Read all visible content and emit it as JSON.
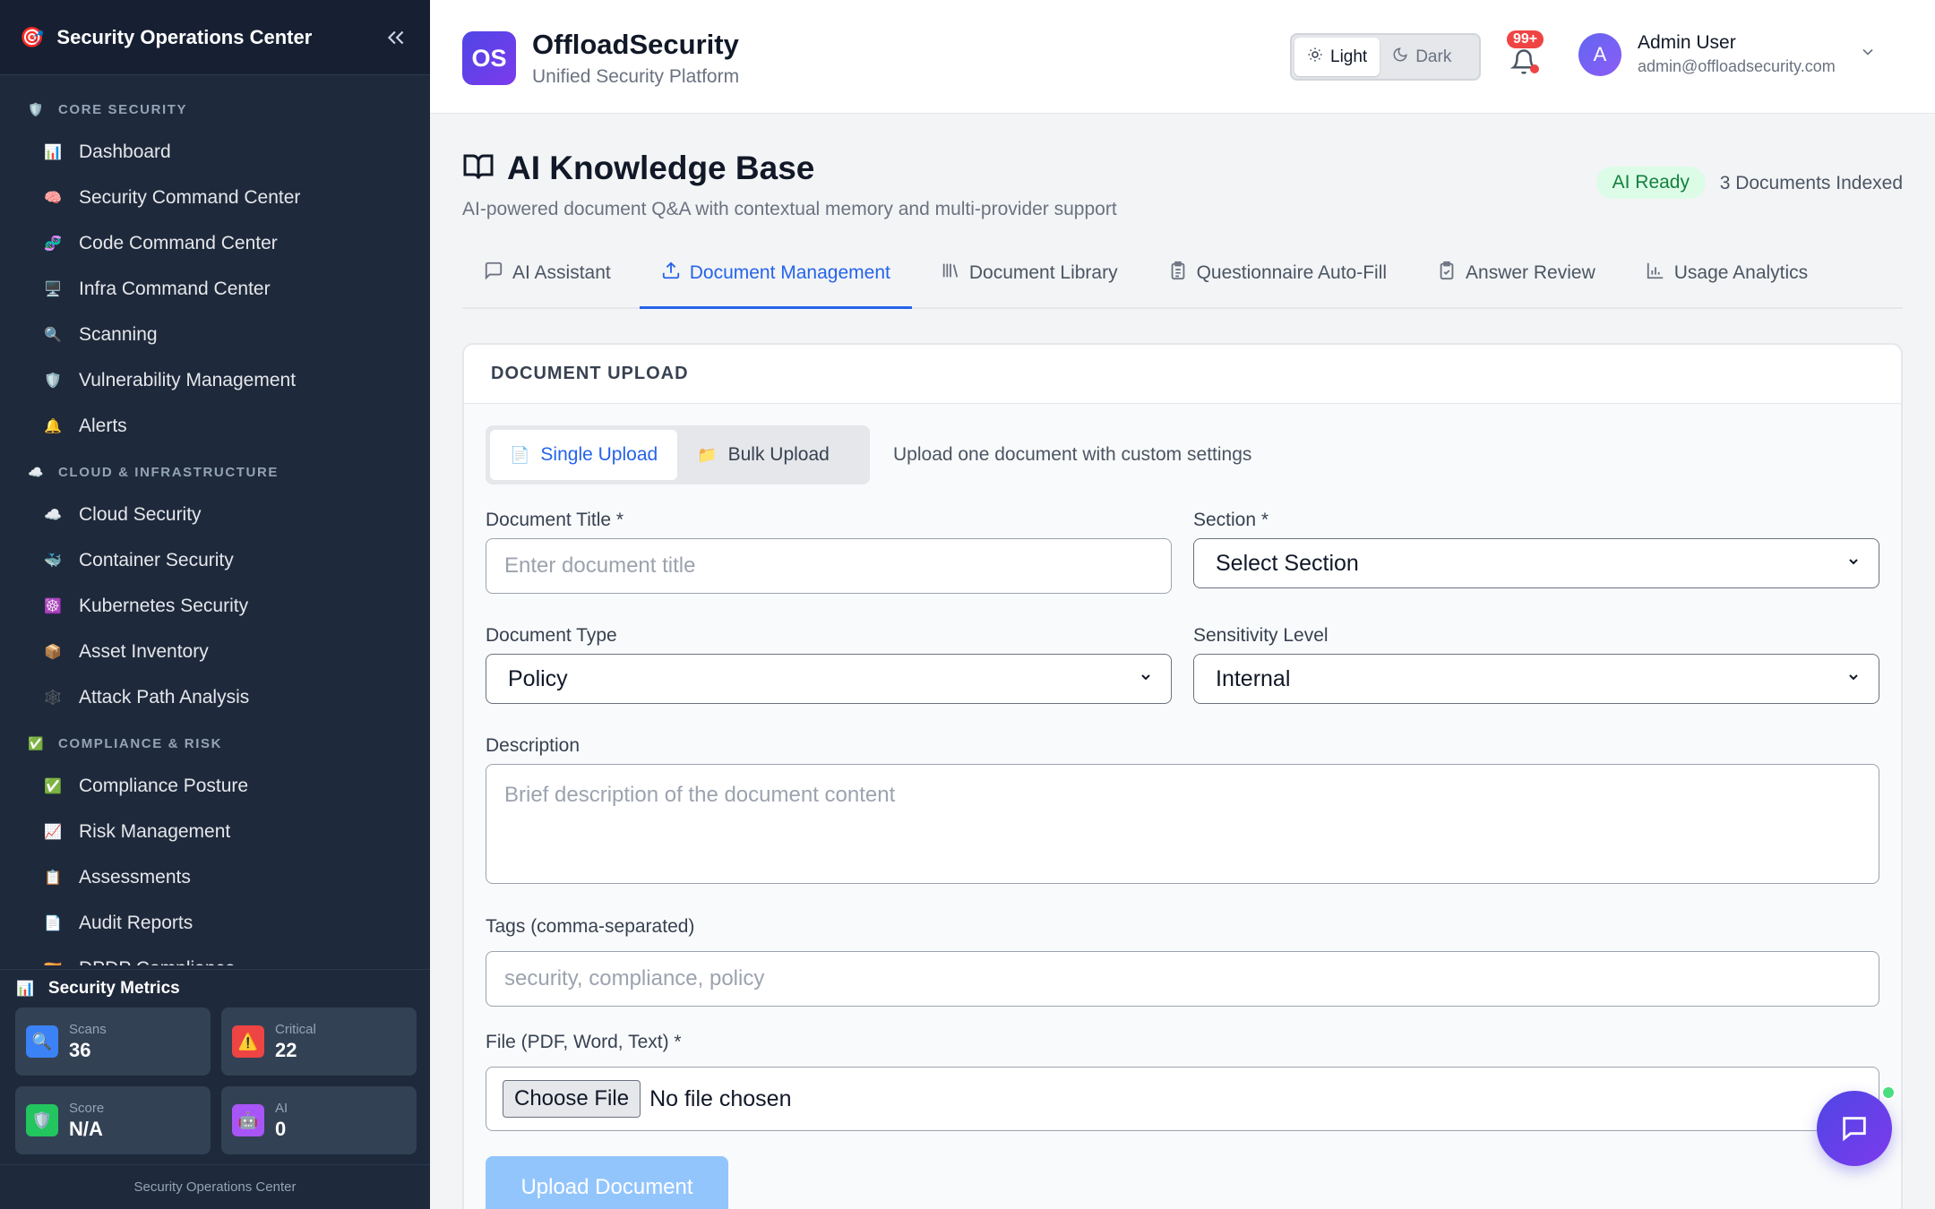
{
  "sidebar": {
    "title": "Security Operations Center",
    "sections": [
      {
        "label": "CORE SECURITY",
        "icon": "🛡️",
        "items": [
          {
            "label": "Dashboard",
            "icon": "📊"
          },
          {
            "label": "Security Command Center",
            "icon": "🧠"
          },
          {
            "label": "Code Command Center",
            "icon": "🧬"
          },
          {
            "label": "Infra Command Center",
            "icon": "🖥️"
          },
          {
            "label": "Scanning",
            "icon": "🔍"
          },
          {
            "label": "Vulnerability Management",
            "icon": "🛡️"
          },
          {
            "label": "Alerts",
            "icon": "🔔"
          }
        ]
      },
      {
        "label": "CLOUD & INFRASTRUCTURE",
        "icon": "☁️",
        "items": [
          {
            "label": "Cloud Security",
            "icon": "☁️"
          },
          {
            "label": "Container Security",
            "icon": "🐳"
          },
          {
            "label": "Kubernetes Security",
            "icon": "☸️"
          },
          {
            "label": "Asset Inventory",
            "icon": "📦"
          },
          {
            "label": "Attack Path Analysis",
            "icon": "🕸️"
          }
        ]
      },
      {
        "label": "COMPLIANCE & RISK",
        "icon": "✅",
        "items": [
          {
            "label": "Compliance Posture",
            "icon": "✅"
          },
          {
            "label": "Risk Management",
            "icon": "📈"
          },
          {
            "label": "Assessments",
            "icon": "📋"
          },
          {
            "label": "Audit Reports",
            "icon": "📄"
          },
          {
            "label": "DPDP Compliance",
            "icon": "🇮🇳"
          }
        ]
      }
    ],
    "metrics_title": "Security Metrics",
    "metrics": [
      {
        "label": "Scans",
        "value": "36",
        "icon": "🔍",
        "color": "#3b82f6"
      },
      {
        "label": "Critical",
        "value": "22",
        "icon": "⚠️",
        "color": "#ef4444"
      },
      {
        "label": "Score",
        "value": "N/A",
        "icon": "🛡️",
        "color": "#22c55e"
      },
      {
        "label": "AI",
        "value": "0",
        "icon": "🤖",
        "color": "#a855f7"
      }
    ],
    "footer": "Security Operations Center"
  },
  "header": {
    "logo_text": "OS",
    "brand": "OffloadSecurity",
    "tagline": "Unified Security Platform",
    "theme_light": "Light",
    "theme_dark": "Dark",
    "notification_count": "99+",
    "user_initial": "A",
    "user_name": "Admin User",
    "user_email": "admin@offloadsecurity.com"
  },
  "page": {
    "title": "AI Knowledge Base",
    "description": "AI-powered document Q&A with contextual memory and multi-provider support",
    "status_badge": "AI Ready",
    "documents_indexed": "3 Documents Indexed",
    "tabs": [
      {
        "label": "AI Assistant",
        "icon": "💬"
      },
      {
        "label": "Document Management",
        "icon": "⇪"
      },
      {
        "label": "Document Library",
        "icon": "📚"
      },
      {
        "label": "Questionnaire Auto-Fill",
        "icon": "📋"
      },
      {
        "label": "Answer Review",
        "icon": "📝"
      },
      {
        "label": "Usage Analytics",
        "icon": "📊"
      }
    ],
    "active_tab": "Document Management"
  },
  "upload": {
    "card_title": "DOCUMENT UPLOAD",
    "single_label": "Single Upload",
    "bulk_label": "Bulk Upload",
    "hint": "Upload one document with custom settings",
    "title_label": "Document Title *",
    "title_placeholder": "Enter document title",
    "section_label": "Section *",
    "section_value": "Select Section",
    "type_label": "Document Type",
    "type_value": "Policy",
    "sensitivity_label": "Sensitivity Level",
    "sensitivity_value": "Internal",
    "description_label": "Description",
    "description_placeholder": "Brief description of the document content",
    "tags_label": "Tags (comma-separated)",
    "tags_placeholder": "security, compliance, policy",
    "file_label": "File (PDF, Word, Text) *",
    "file_button": "Choose File",
    "file_status": "No file chosen",
    "submit_label": "Upload Document"
  },
  "colors": {
    "accent": "#2563eb",
    "sidebar_bg": "#1e293b",
    "brand_gradient_start": "#4f46e5",
    "brand_gradient_end": "#7c3aed"
  }
}
